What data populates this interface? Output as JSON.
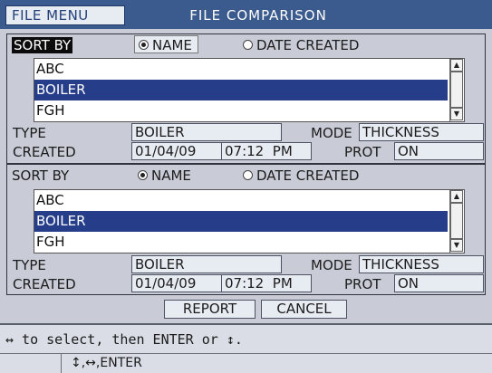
{
  "title_bar": {
    "menu_label": "FILE MENU",
    "title": "FILE COMPARISON"
  },
  "panels": [
    {
      "sort_by_label": "SORT BY",
      "sort_options": [
        {
          "label": "NAME",
          "selected": true
        },
        {
          "label": "DATE CREATED",
          "selected": false
        }
      ],
      "files": [
        {
          "name": "ABC",
          "selected": false
        },
        {
          "name": "BOILER",
          "selected": true
        },
        {
          "name": "FGH",
          "selected": false
        }
      ],
      "type_label": "TYPE",
      "type_value": "BOILER",
      "mode_label": "MODE",
      "mode_value": "THICKNESS",
      "created_label": "CREATED",
      "created_date": "01/04/09",
      "created_time": "07:12",
      "created_ampm": "PM",
      "prot_label": "PROT",
      "prot_value": "ON"
    },
    {
      "sort_by_label": "SORT BY",
      "sort_options": [
        {
          "label": "NAME",
          "selected": true
        },
        {
          "label": "DATE CREATED",
          "selected": false
        }
      ],
      "files": [
        {
          "name": "ABC",
          "selected": false
        },
        {
          "name": "BOILER",
          "selected": true
        },
        {
          "name": "FGH",
          "selected": false
        }
      ],
      "type_label": "TYPE",
      "type_value": "BOILER",
      "mode_label": "MODE",
      "mode_value": "THICKNESS",
      "created_label": "CREATED",
      "created_date": "01/04/09",
      "created_time": "07:12",
      "created_ampm": "PM",
      "prot_label": "PROT",
      "prot_value": "ON"
    }
  ],
  "buttons": {
    "report": "REPORT",
    "cancel": "CANCEL"
  },
  "status": {
    "message": "↔ to select, then ENTER or ↕.",
    "keys": "↕,↔,ENTER"
  },
  "colors": {
    "title_bar": "#3b5b8e",
    "selection": "#263d8a",
    "background": "#c9ccd6"
  }
}
